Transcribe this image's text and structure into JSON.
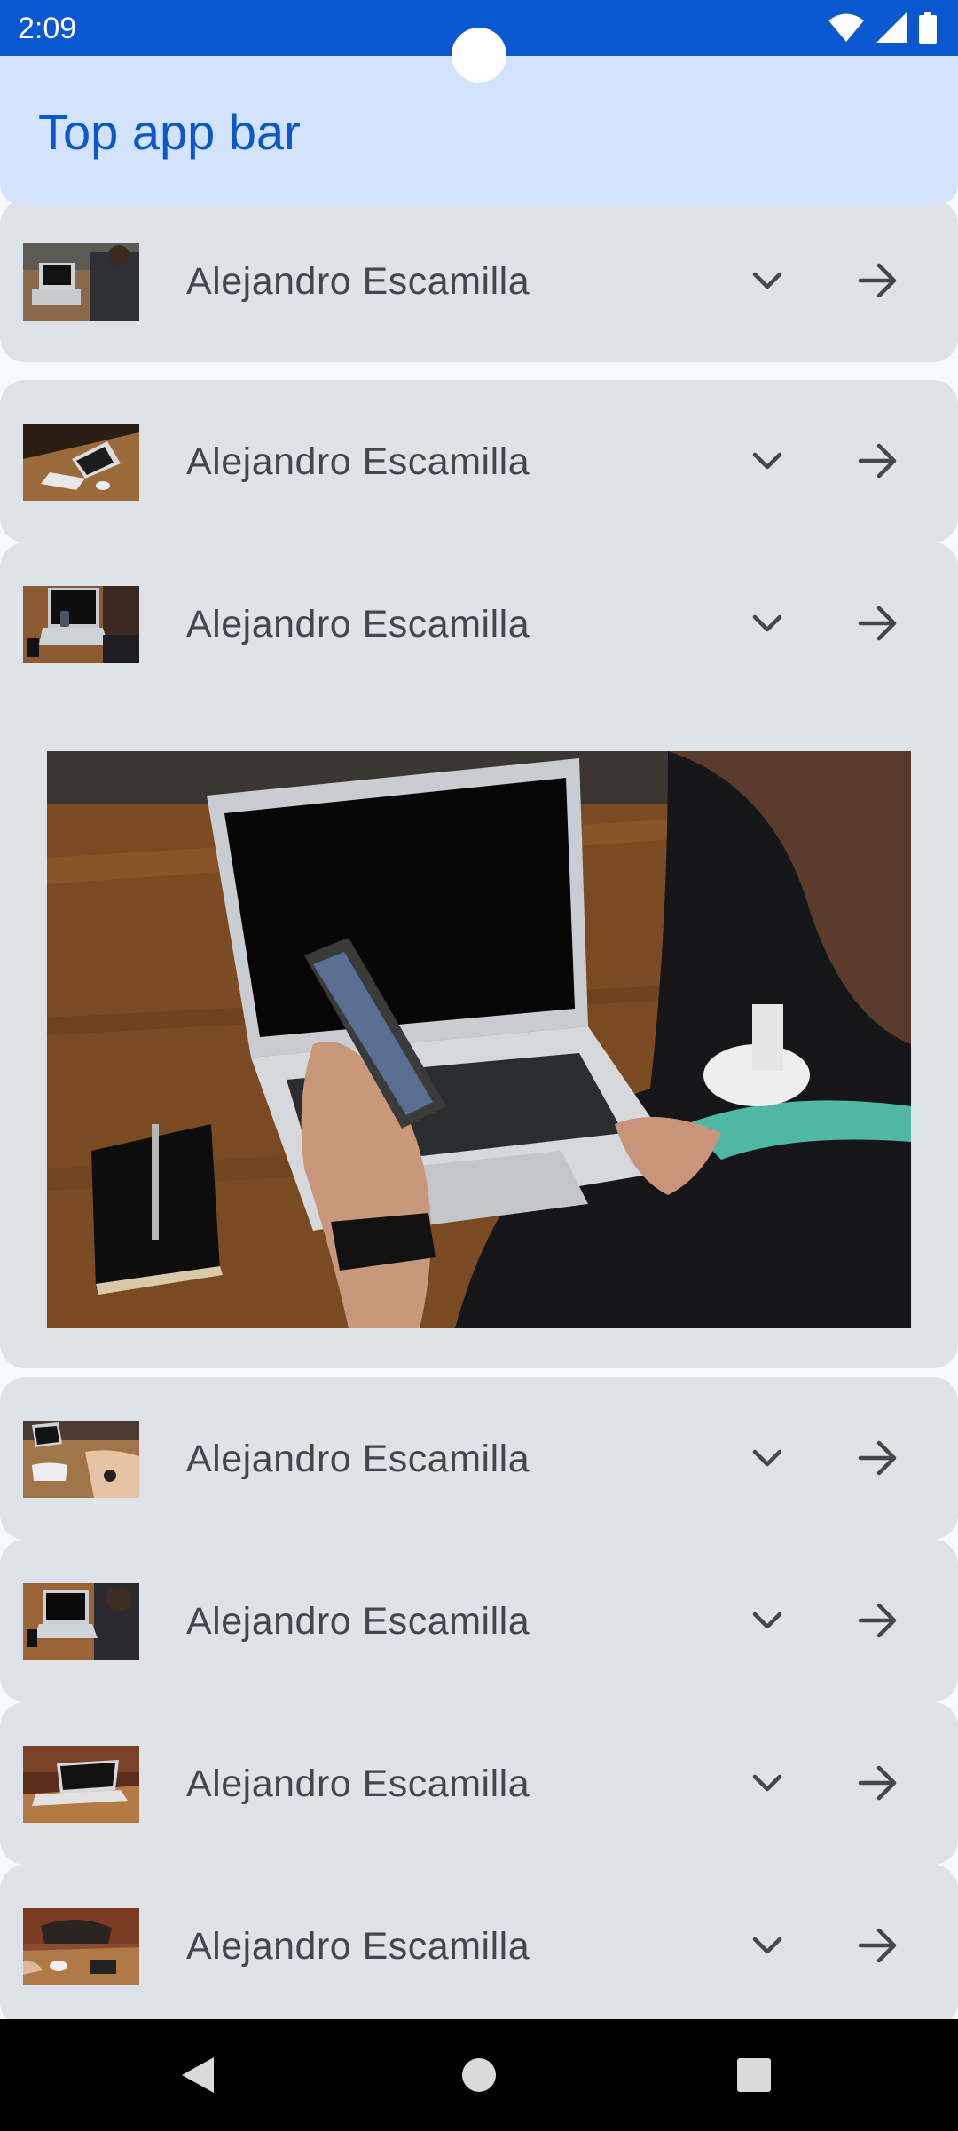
{
  "status_bar": {
    "time": "2:09",
    "icons": [
      "wifi-icon",
      "signal-icon",
      "battery-icon"
    ]
  },
  "app_bar": {
    "title": "Top app bar"
  },
  "list": {
    "items": [
      {
        "author": "Alejandro Escamilla",
        "thumbnail": "laptop-man-photo",
        "expanded": false
      },
      {
        "author": "Alejandro Escamilla",
        "thumbnail": "laptop-desk-photo",
        "expanded": false
      },
      {
        "author": "Alejandro Escamilla",
        "thumbnail": "phone-laptop-photo",
        "expanded": true
      },
      {
        "author": "Alejandro Escamilla",
        "thumbnail": "hands-desk-photo",
        "expanded": false
      },
      {
        "author": "Alejandro Escamilla",
        "thumbnail": "laptop-man-photo-2",
        "expanded": false
      },
      {
        "author": "Alejandro Escamilla",
        "thumbnail": "laptop-table-photo",
        "expanded": false
      },
      {
        "author": "Alejandro Escamilla",
        "thumbnail": "meeting-table-photo",
        "expanded": false
      }
    ],
    "row_icons": [
      "chevron-down-icon",
      "arrow-forward-icon"
    ]
  },
  "nav_bar": {
    "buttons": [
      "back-icon",
      "home-icon",
      "recents-icon"
    ]
  },
  "colors": {
    "status_bar": "#0b57d0",
    "app_bar": "#d3e3fd",
    "title": "#0b57d0",
    "card": "#dee3ea",
    "text": "#44474e"
  }
}
